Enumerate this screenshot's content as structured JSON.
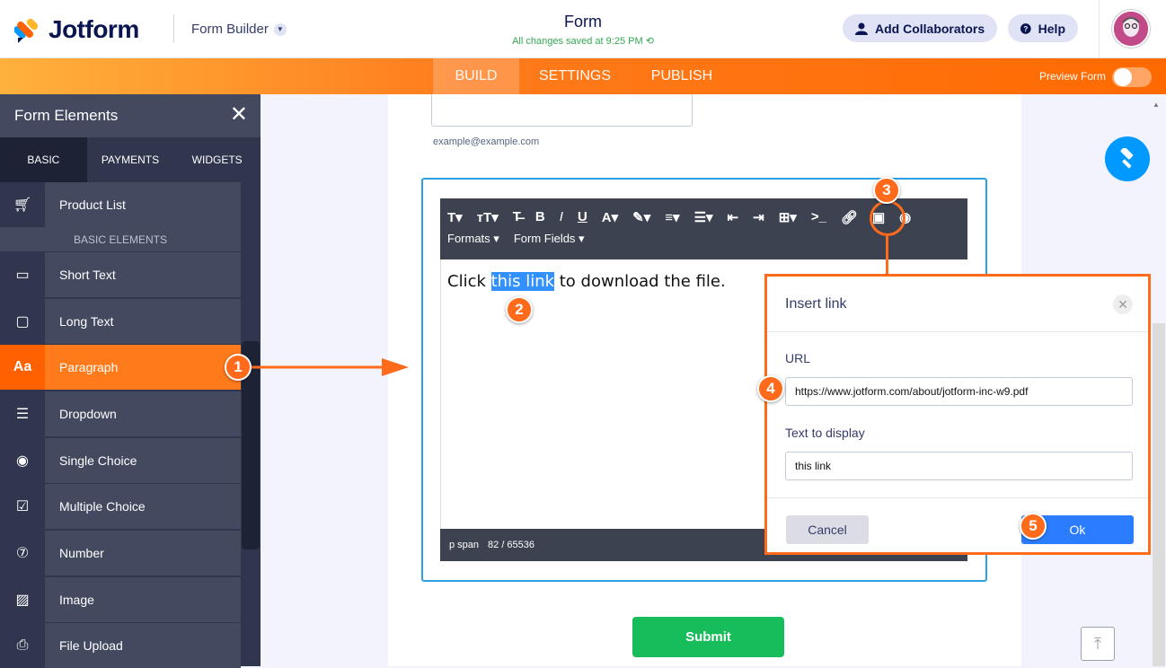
{
  "header": {
    "brand": "Jotform",
    "form_builder": "Form Builder",
    "form_title": "Form",
    "saved_status": "All changes saved at 9:25 PM",
    "add_collaborators": "Add Collaborators",
    "help": "Help"
  },
  "nav": {
    "tabs": [
      "BUILD",
      "SETTINGS",
      "PUBLISH"
    ],
    "active_tab": "BUILD",
    "preview_label": "Preview Form",
    "preview_on": false
  },
  "sidebar": {
    "title": "Form Elements",
    "tabs": [
      "BASIC",
      "PAYMENTS",
      "WIDGETS"
    ],
    "section_label": "BASIC ELEMENTS",
    "items": [
      {
        "label": "Product List",
        "icon": "cart-icon"
      },
      {
        "label": "Short Text",
        "icon": "short-text-icon"
      },
      {
        "label": "Long Text",
        "icon": "long-text-icon"
      },
      {
        "label": "Paragraph",
        "icon": "paragraph-icon"
      },
      {
        "label": "Dropdown",
        "icon": "dropdown-icon"
      },
      {
        "label": "Single Choice",
        "icon": "radio-icon"
      },
      {
        "label": "Multiple Choice",
        "icon": "checkbox-icon"
      },
      {
        "label": "Number",
        "icon": "number-icon"
      },
      {
        "label": "Image",
        "icon": "image-icon"
      },
      {
        "label": "File Upload",
        "icon": "upload-icon"
      }
    ],
    "selected": "Paragraph"
  },
  "form": {
    "email_hint": "example@example.com",
    "toolbar_row2": [
      "Formats",
      "Form Fields"
    ],
    "editor_before": "Click ",
    "editor_link": "this link",
    "editor_after": " to download the file.",
    "status_path": "p  span",
    "status_count": "82 / 65536",
    "submit_label": "Submit"
  },
  "dialog": {
    "title": "Insert link",
    "url_label": "URL",
    "url_value": "https://www.jotform.com/about/jotform-inc-w9.pdf",
    "text_label": "Text to display",
    "text_value": "this link",
    "cancel": "Cancel",
    "ok": "Ok"
  },
  "badges": [
    "1",
    "2",
    "3",
    "4",
    "5"
  ],
  "colors": {
    "accent": "#ff6b1a",
    "primary": "#2b7cff",
    "submit": "#18bd5b",
    "brand": "#0a1551"
  }
}
